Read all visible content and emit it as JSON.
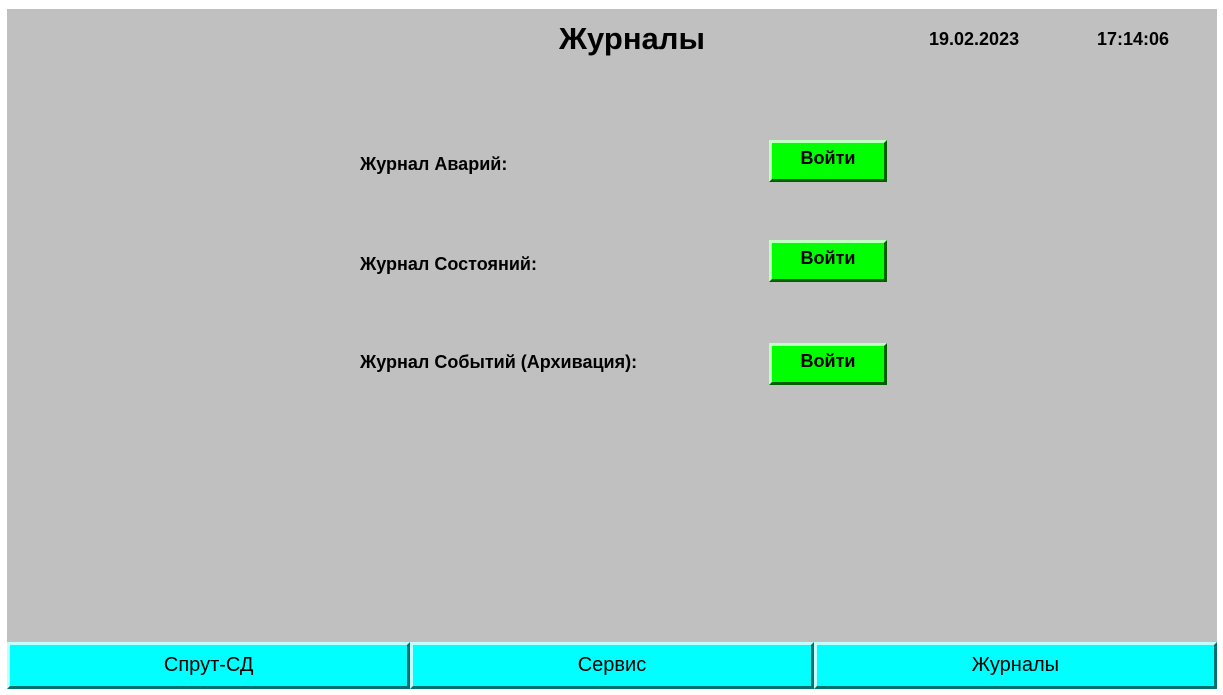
{
  "header": {
    "title": "Журналы",
    "date": "19.02.2023",
    "time": "17:14:06"
  },
  "journals": [
    {
      "label": "Журнал Аварий:",
      "button": "Войти"
    },
    {
      "label": "Журнал Состояний:",
      "button": "Войти"
    },
    {
      "label": "Журнал Событий (Архивация):",
      "button": "Войти"
    }
  ],
  "nav": {
    "tabs": [
      {
        "label": "Спрут-СД"
      },
      {
        "label": "Сервис"
      },
      {
        "label": "Журналы"
      }
    ]
  },
  "colors": {
    "background": "#c0c0c0",
    "enter_button": "#00ff00",
    "nav_tab": "#00ffff"
  }
}
